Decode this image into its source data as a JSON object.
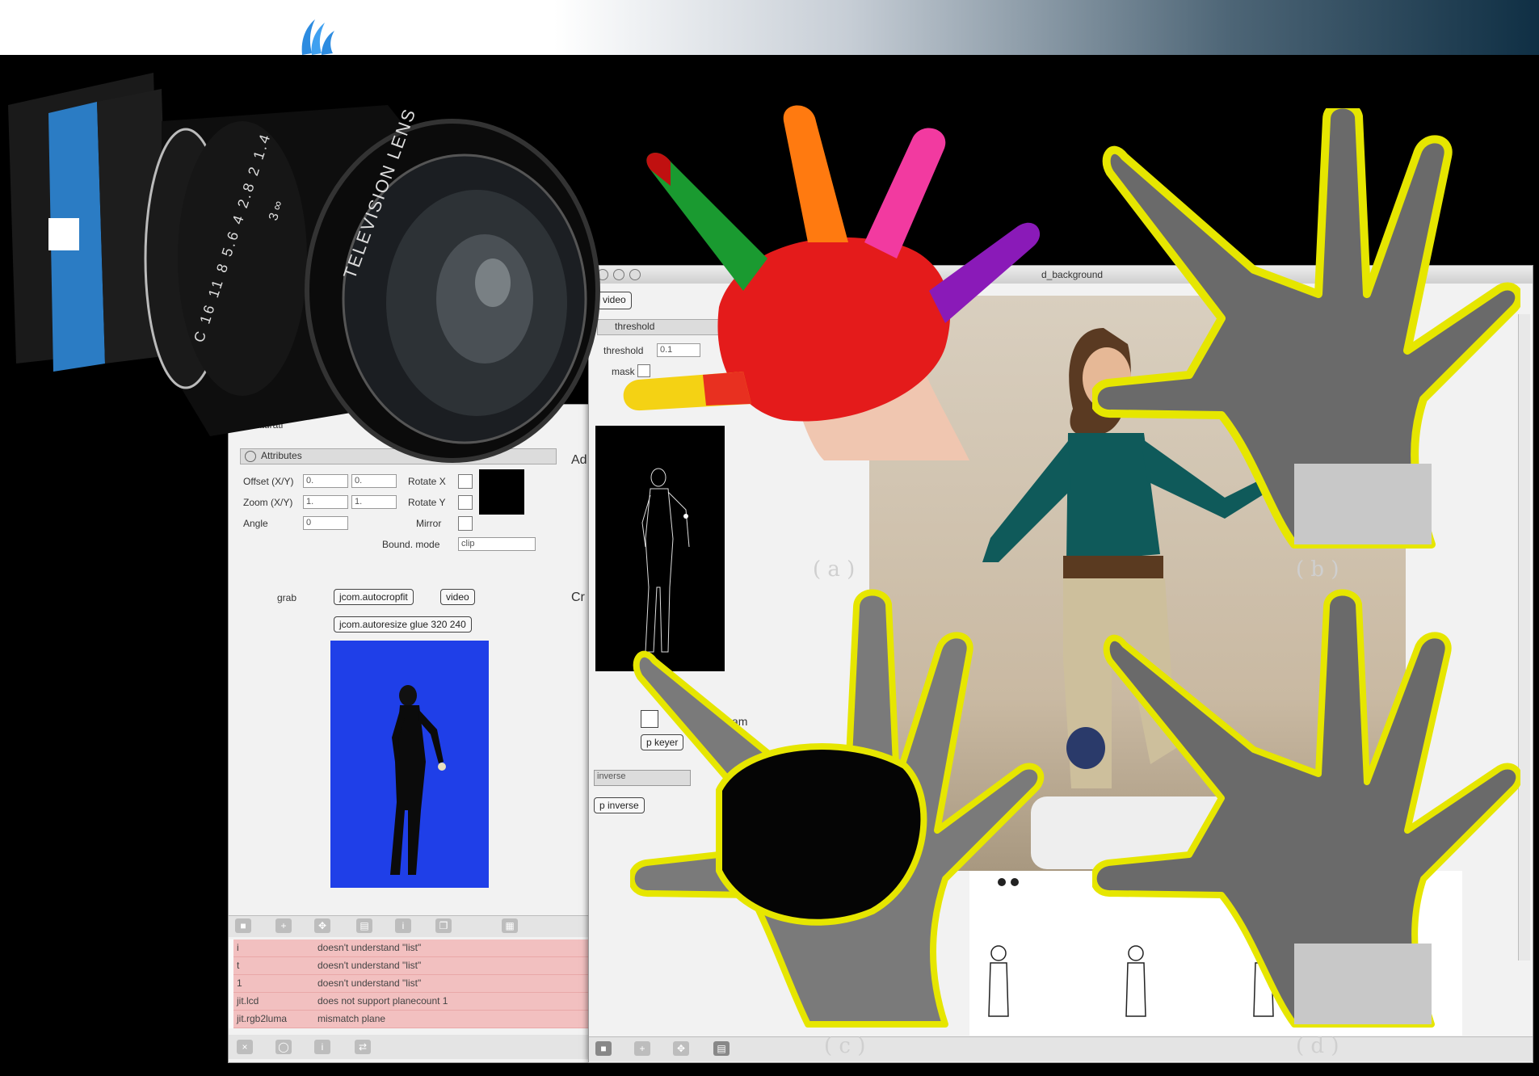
{
  "colors": {
    "topbar_start": "#ffffff",
    "topbar_end": "#0f2f44",
    "blue_screen": "#1f3fe8",
    "error_row": "#f2c0c0",
    "hand_yellow": "#e6e600"
  },
  "logo": {
    "icon": "wave-logo-icon"
  },
  "camera": {
    "icon": "camera-lens-icon",
    "lens_text": "TELEVISION LENS",
    "ring_numbers": "C 16 11 8 5.6 4 2.8 2 1.4",
    "distance_marks": "3 ∞"
  },
  "left_window": {
    "section_label": "saturati",
    "section_title": "Attributes",
    "rows": [
      {
        "label": "Offset (X/Y)",
        "v1": "0.",
        "v2": "0."
      },
      {
        "label": "Zoom (X/Y)",
        "v1": "1.",
        "v2": "1."
      },
      {
        "label": "Angle",
        "v1": "0"
      }
    ],
    "rotate_labels": [
      "Rotate X",
      "Rotate Y",
      "Mirror",
      "Bound. mode"
    ],
    "bound_mode_value": "clip",
    "side_labels": [
      "Ad",
      "Cr"
    ],
    "patch": {
      "label": "grab",
      "msg1": "jcom.autocropfit",
      "msg2": "video",
      "msg3": "jcom.autoresize glue 320 240"
    },
    "console": [
      {
        "obj": "i",
        "msg": "doesn't understand \"list\""
      },
      {
        "obj": "t",
        "msg": "doesn't understand \"list\""
      },
      {
        "obj": "1",
        "msg": "doesn't understand \"list\""
      },
      {
        "obj": "jit.lcd",
        "msg": "does not support planecount 1"
      },
      {
        "obj": "jit.rgb2luma",
        "msg": "mismatch plane"
      }
    ]
  },
  "right_window": {
    "tab": "video",
    "section": "threshold",
    "threshold_label": "threshold",
    "threshold_value": "0.1",
    "mask_label": "mask",
    "title_fragment": "d_background",
    "side_text": "sam",
    "key_label": "p keyer",
    "menu_value": "inverse",
    "bottom_label": "p inverse"
  },
  "captions": {
    "a": "( a )",
    "b": "( b )",
    "c": "( c )",
    "d": "( d )"
  }
}
